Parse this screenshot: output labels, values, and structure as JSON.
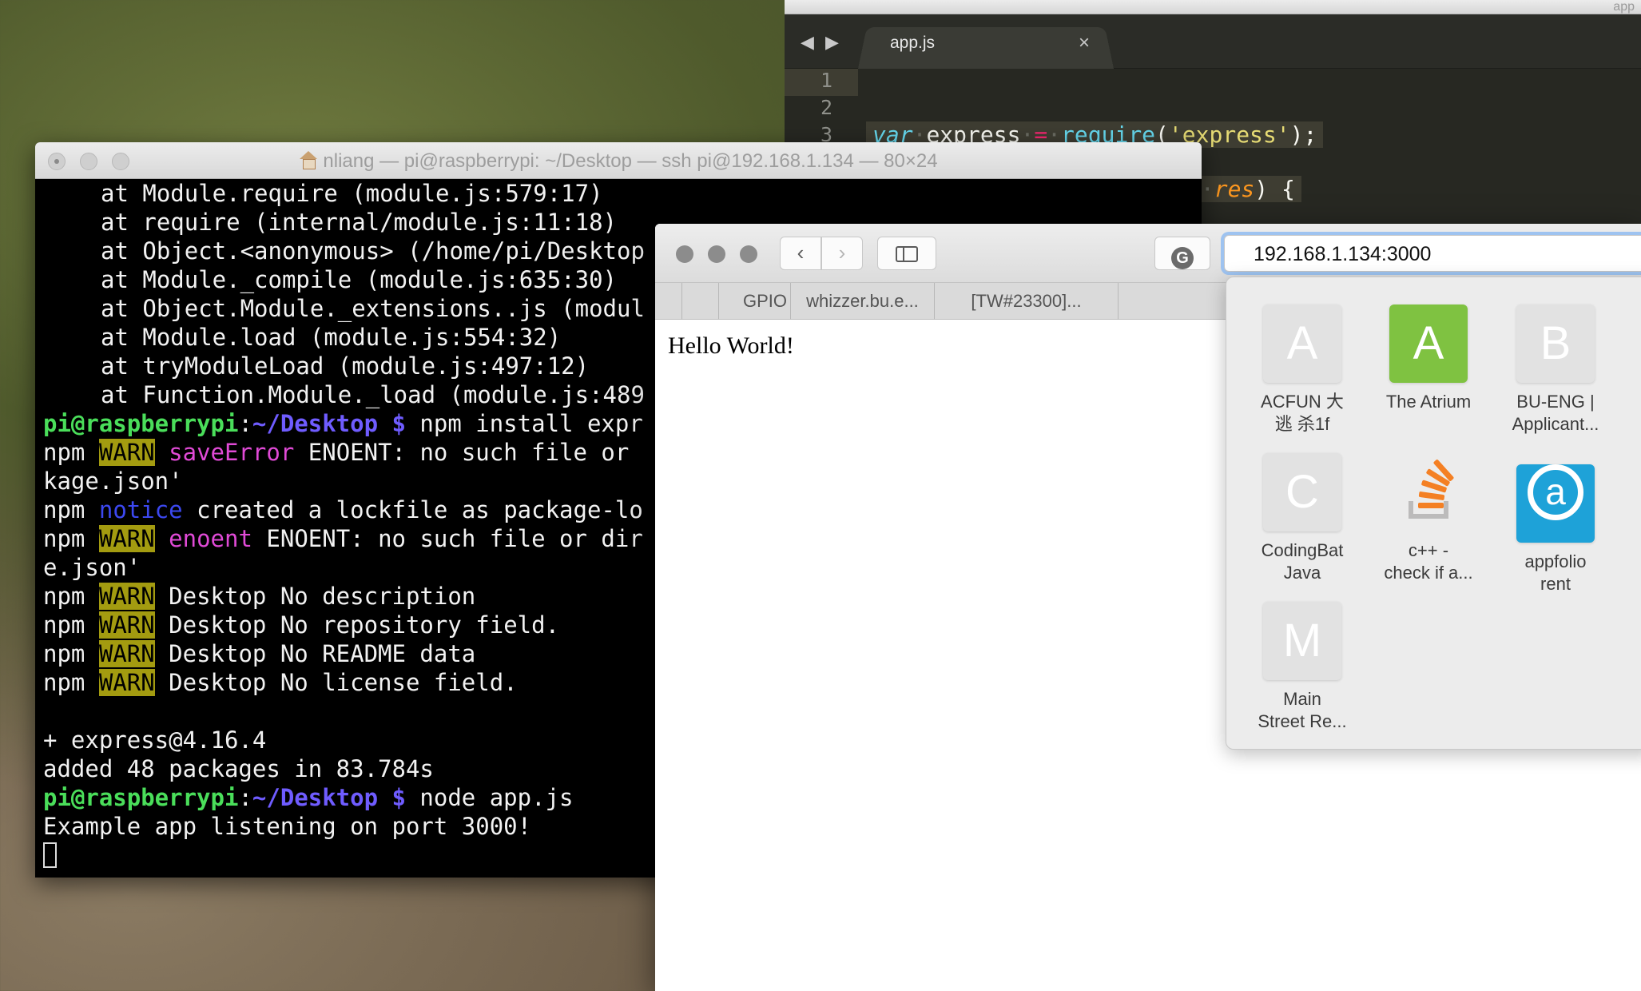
{
  "editor": {
    "title_partial": "app",
    "tab_label": "app.js",
    "tab_close": "×",
    "nav_arrows": "◀ ▶",
    "line_numbers": [
      "1",
      "2",
      "3"
    ],
    "line3": {
      "kw": "var",
      "id": "express",
      "op": "=",
      "fn": "require",
      "open": "(",
      "str": "'express'",
      "close": ");"
    },
    "line4_partial": {
      "comma": ",",
      "param": "res",
      "rest": ") {"
    }
  },
  "terminal": {
    "title": "nliang — pi@raspberrypi: ~/Desktop — ssh pi@192.168.1.134 — 80×24",
    "stack_lines": [
      "at Module.require (module.js:579:17)",
      "at require (internal/module.js:11:18)",
      "at Object.<anonymous> (/home/pi/Desktop",
      "at Module._compile (module.js:635:30)",
      "at Object.Module._extensions..js (modul",
      "at Module.load (module.js:554:32)",
      "at tryModuleLoad (module.js:497:12)",
      "at Function.Module._load (module.js:489"
    ],
    "prompt_user": "pi@raspberrypi",
    "prompt_sep": ":",
    "prompt_path": "~/Desktop $",
    "cmd1": " npm install expr",
    "npm": "npm",
    "warn": "WARN",
    "notice": "notice",
    "save_error_tag": "saveError",
    "save_error_msg": " ENOENT: no such file or",
    "save_error_cont": "kage.json'",
    "notice_msg": " created a lockfile as package-lo",
    "enoent_tag": "enoent",
    "enoent_msg": " ENOENT: no such file or dir",
    "enoent_cont": "e.json'",
    "warn_lines": [
      " Desktop No description",
      " Desktop No repository field.",
      " Desktop No README data",
      " Desktop No license field."
    ],
    "installed": "+ express@4.16.4",
    "added": "added 48 packages in 83.784s",
    "cmd2": " node app.js",
    "listening": "Example app listening on port 3000!"
  },
  "browser": {
    "url": "192.168.1.134:3000",
    "back": "‹",
    "forward": "›",
    "ext_icon": "G",
    "bookmarks": [
      "GPIO",
      "whizzer.bu.e...",
      "[TW#23300]..."
    ],
    "page_text": "Hello World!"
  },
  "favorites": [
    {
      "letter": "A",
      "label1": "ACFUN 大",
      "label2": "逃 杀1f",
      "style": "gray"
    },
    {
      "letter": "A",
      "label1": "The Atrium",
      "label2": "",
      "style": "green"
    },
    {
      "letter": "B",
      "label1": "BU-ENG |",
      "label2": "Applicant...",
      "style": "gray"
    },
    {
      "letter": "C",
      "label1": "CodingBat",
      "label2": "Java",
      "style": "gray"
    },
    {
      "letter": "",
      "label1": "c++ -",
      "label2": "check if a...",
      "style": "so"
    },
    {
      "letter": "a",
      "label1": "appfolio",
      "label2": "rent",
      "style": "blue"
    },
    {
      "letter": "M",
      "label1": "Main",
      "label2": "Street Re...",
      "style": "gray"
    }
  ]
}
